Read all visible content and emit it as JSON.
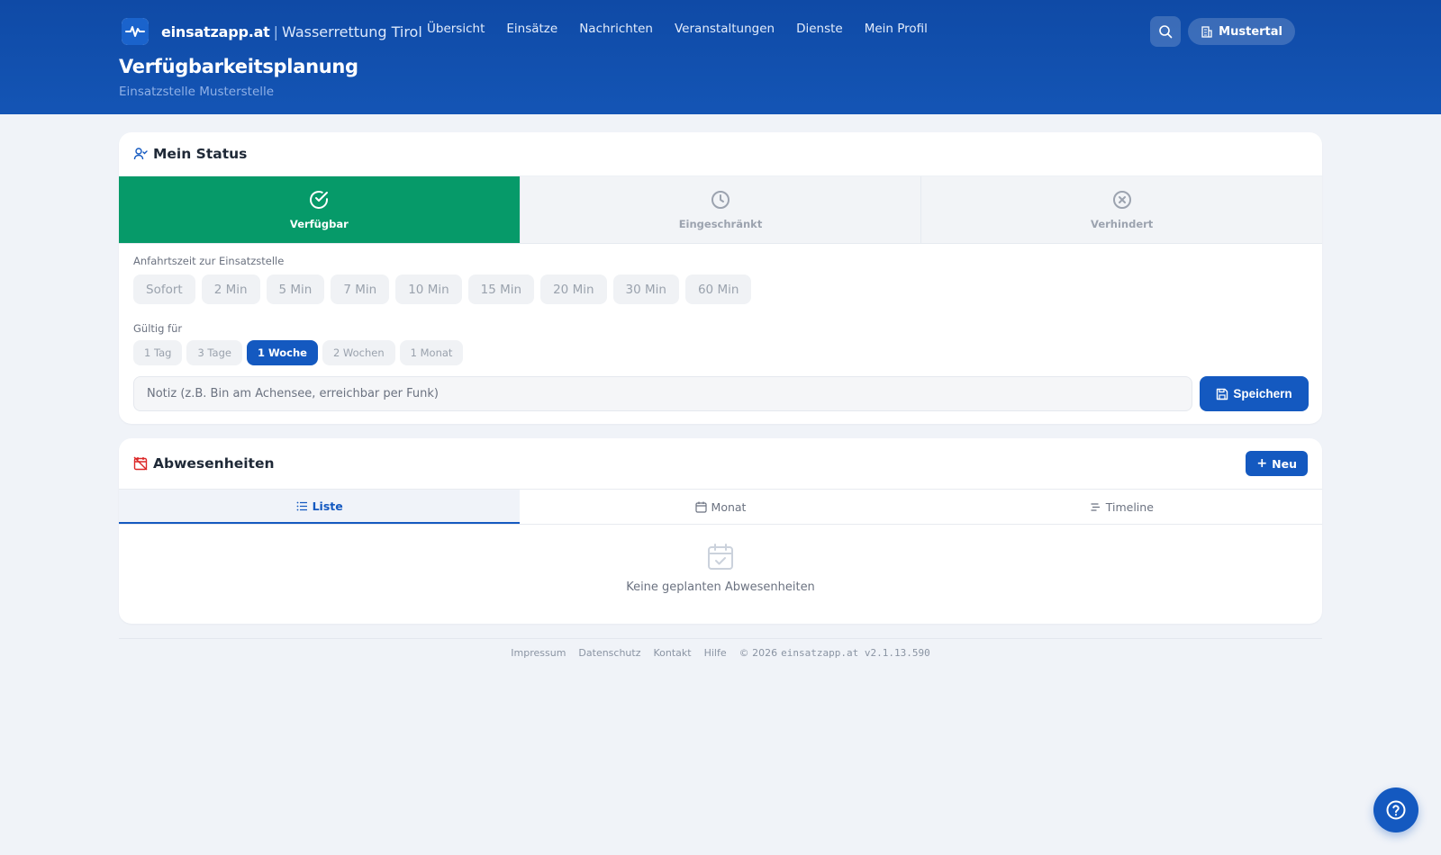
{
  "header": {
    "brand_name": "einsatzapp.at",
    "brand_separator": "|",
    "brand_org": "Wasserrettung Tirol",
    "nav": [
      {
        "label": "Übersicht"
      },
      {
        "label": "Einsätze"
      },
      {
        "label": "Nachrichten"
      },
      {
        "label": "Veranstaltungen"
      },
      {
        "label": "Dienste"
      },
      {
        "label": "Mein Profil"
      }
    ],
    "org_button": "Mustertal",
    "title": "Verfügbarkeitsplanung",
    "subtitle": "Einsatzstelle Musterstelle"
  },
  "status": {
    "title": "Mein Status",
    "options": [
      {
        "label": "Verfügbar",
        "icon": "check-circle-icon",
        "active": true
      },
      {
        "label": "Eingeschränkt",
        "icon": "clock-icon",
        "active": false
      },
      {
        "label": "Verhindert",
        "icon": "x-circle-icon",
        "active": false
      }
    ],
    "travel_label": "Anfahrtszeit zur Einsatzstelle",
    "travel_options": [
      "Sofort",
      "2 Min",
      "5 Min",
      "7 Min",
      "10 Min",
      "15 Min",
      "20 Min",
      "30 Min",
      "60 Min"
    ],
    "valid_label": "Gültig für",
    "valid_options": [
      "1 Tag",
      "3 Tage",
      "1 Woche",
      "2 Wochen",
      "1 Monat"
    ],
    "valid_selected": "1 Woche",
    "note_placeholder": "Notiz (z.B. Bin am Achensee, erreichbar per Funk)",
    "save_label": "Speichern"
  },
  "absences": {
    "title": "Abwesenheiten",
    "new_label": "Neu",
    "tabs": [
      {
        "label": "Liste",
        "icon": "list-icon",
        "active": true
      },
      {
        "label": "Monat",
        "icon": "calendar-icon",
        "active": false
      },
      {
        "label": "Timeline",
        "icon": "timeline-icon",
        "active": false
      }
    ],
    "empty_text": "Keine geplanten Abwesenheiten"
  },
  "footer": {
    "links": [
      "Impressum",
      "Datenschutz",
      "Kontakt",
      "Hilfe"
    ],
    "copyright": "© 2026",
    "version": "einsatzapp.at v2.1.13.590"
  },
  "colors": {
    "header": "#1455b5",
    "accent": "#1459c0",
    "available": "#069a69"
  }
}
